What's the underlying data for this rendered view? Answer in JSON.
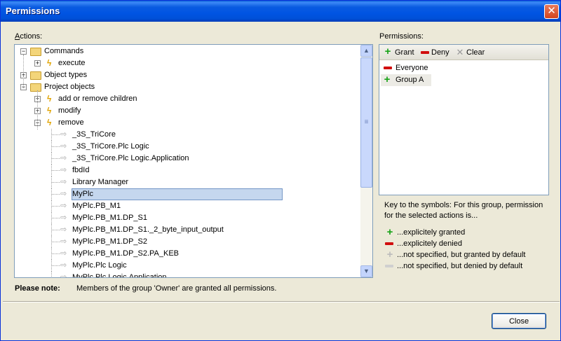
{
  "window": {
    "title": "Permissions",
    "close_glyph": "✕"
  },
  "actions": {
    "label_prefix": "A",
    "label_rest": "ctions:",
    "tree": [
      {
        "depth": 0,
        "expander": "−",
        "icon": "folder-icon",
        "label": "Commands"
      },
      {
        "depth": 1,
        "expander": "+",
        "icon": "bolt-icon",
        "label": "execute"
      },
      {
        "depth": 0,
        "expander": "+",
        "icon": "folder-icon",
        "label": "Object types"
      },
      {
        "depth": 0,
        "expander": "−",
        "icon": "folder-icon",
        "label": "Project objects"
      },
      {
        "depth": 1,
        "expander": "+",
        "icon": "bolt-icon",
        "label": "add or remove children"
      },
      {
        "depth": 1,
        "expander": "+",
        "icon": "bolt-icon",
        "label": "modify"
      },
      {
        "depth": 1,
        "expander": "−",
        "icon": "bolt-icon",
        "label": "remove"
      },
      {
        "depth": 2,
        "icon": "arrow-icon",
        "label": "_3S_TriCore"
      },
      {
        "depth": 2,
        "icon": "arrow-icon",
        "label": "_3S_TriCore.Plc Logic"
      },
      {
        "depth": 2,
        "icon": "arrow-icon",
        "label": "_3S_TriCore.Plc Logic.Application"
      },
      {
        "depth": 2,
        "icon": "arrow-icon",
        "label": "fbdId"
      },
      {
        "depth": 2,
        "icon": "arrow-icon",
        "label": "Library Manager"
      },
      {
        "depth": 2,
        "icon": "arrow-icon",
        "label": "MyPlc",
        "selected": true
      },
      {
        "depth": 2,
        "icon": "arrow-icon",
        "label": "MyPlc.PB_M1"
      },
      {
        "depth": 2,
        "icon": "arrow-icon",
        "label": "MyPlc.PB_M1.DP_S1"
      },
      {
        "depth": 2,
        "icon": "arrow-icon",
        "label": "MyPlc.PB_M1.DP_S1._2_byte_input_output"
      },
      {
        "depth": 2,
        "icon": "arrow-icon",
        "label": "MyPlc.PB_M1.DP_S2"
      },
      {
        "depth": 2,
        "icon": "arrow-icon",
        "label": "MyPlc.PB_M1.DP_S2.PA_KEB"
      },
      {
        "depth": 2,
        "icon": "arrow-icon",
        "label": "MyPlc.Plc Logic"
      },
      {
        "depth": 2,
        "icon": "arrow-icon",
        "label": "MyPlc.Plc Logic.Application"
      }
    ],
    "scroll_up": "▲",
    "scroll_down": "▼",
    "scroll_grip": "≡"
  },
  "permissions": {
    "label": "Permissions:",
    "toolbar": {
      "grant": "Grant",
      "deny": "Deny",
      "clear": "Clear"
    },
    "groups": [
      {
        "name": "Everyone",
        "state": "denied"
      },
      {
        "name": "Group A",
        "state": "granted"
      }
    ]
  },
  "key": {
    "intro": "Key to the symbols: For this group, permission for the selected actions is...",
    "items": [
      {
        "symbol": "plus",
        "color": "#17a317",
        "text": "...explicitely granted"
      },
      {
        "symbol": "minus",
        "color": "#d10e0e",
        "text": "...explicitely denied"
      },
      {
        "symbol": "plus-grey",
        "color": "#bcbcbc",
        "text": "...not specified, but granted by default"
      },
      {
        "symbol": "minus-grey",
        "color": "#cfcfcf",
        "text": "...not specified, but denied by default"
      }
    ]
  },
  "note": {
    "label": "Please note:",
    "text": "Members of the group 'Owner' are granted all permissions."
  },
  "buttons": {
    "close": "Close"
  }
}
